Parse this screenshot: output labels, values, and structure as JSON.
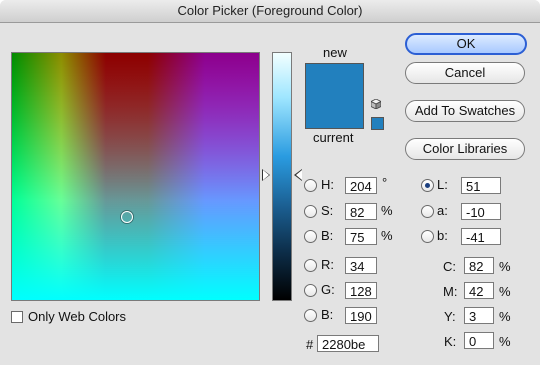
{
  "window": {
    "title": "Color Picker (Foreground Color)"
  },
  "preview": {
    "new_label": "new",
    "current_label": "current",
    "new_color": "#2280be",
    "current_color": "#2280be"
  },
  "buttons": {
    "ok": "OK",
    "cancel": "Cancel",
    "add_to_swatches": "Add To Swatches",
    "color_libraries": "Color Libraries"
  },
  "hsb": {
    "h": {
      "label": "H:",
      "value": "204",
      "unit": "°",
      "selected": false
    },
    "s": {
      "label": "S:",
      "value": "82",
      "unit": "%",
      "selected": false
    },
    "b": {
      "label": "B:",
      "value": "75",
      "unit": "%",
      "selected": false
    }
  },
  "rgb": {
    "r": {
      "label": "R:",
      "value": "34",
      "selected": false
    },
    "g": {
      "label": "G:",
      "value": "128",
      "selected": false
    },
    "b": {
      "label": "B:",
      "value": "190",
      "selected": false
    }
  },
  "lab": {
    "l": {
      "label": "L:",
      "value": "51",
      "selected": true
    },
    "a": {
      "label": "a:",
      "value": "-10",
      "selected": false
    },
    "b": {
      "label": "b:",
      "value": "-41",
      "selected": false
    }
  },
  "cmyk": {
    "c": {
      "label": "C:",
      "value": "82",
      "unit": "%"
    },
    "m": {
      "label": "M:",
      "value": "42",
      "unit": "%"
    },
    "y": {
      "label": "Y:",
      "value": "3",
      "unit": "%"
    },
    "k": {
      "label": "K:",
      "value": "0",
      "unit": "%"
    }
  },
  "hex": {
    "label": "#",
    "value": "2280be"
  },
  "options": {
    "only_web_colors": {
      "label": "Only Web Colors",
      "checked": false
    }
  },
  "icons": {
    "warning_cube": "cube-icon"
  }
}
